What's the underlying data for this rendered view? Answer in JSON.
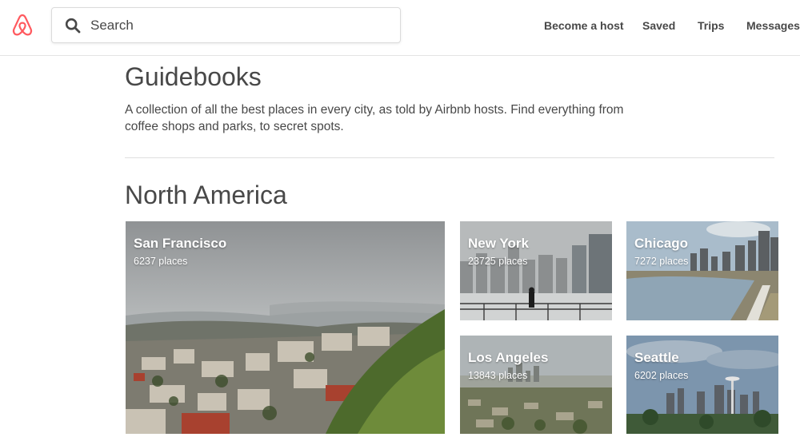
{
  "header": {
    "logo": "airbnb-logo",
    "search": {
      "placeholder": "Search",
      "icon": "search-icon"
    },
    "nav": [
      "Become a host",
      "Saved",
      "Trips",
      "Messages"
    ]
  },
  "page": {
    "title": "Guidebooks",
    "description": "A collection of all the best places in every city, as told by Airbnb hosts. Find everything from coffee shops and parks, to secret spots."
  },
  "section": {
    "title": "North America",
    "cities": [
      {
        "name": "San Francisco",
        "places": "6237 places"
      },
      {
        "name": "New York",
        "places": "23725 places"
      },
      {
        "name": "Chicago",
        "places": "7272 places"
      },
      {
        "name": "Los Angeles",
        "places": "13843 places"
      },
      {
        "name": "Seattle",
        "places": "6202 places"
      }
    ]
  },
  "colors": {
    "brand": "#FF5A5F",
    "text": "#484848",
    "divider": "#DFDFDF"
  }
}
